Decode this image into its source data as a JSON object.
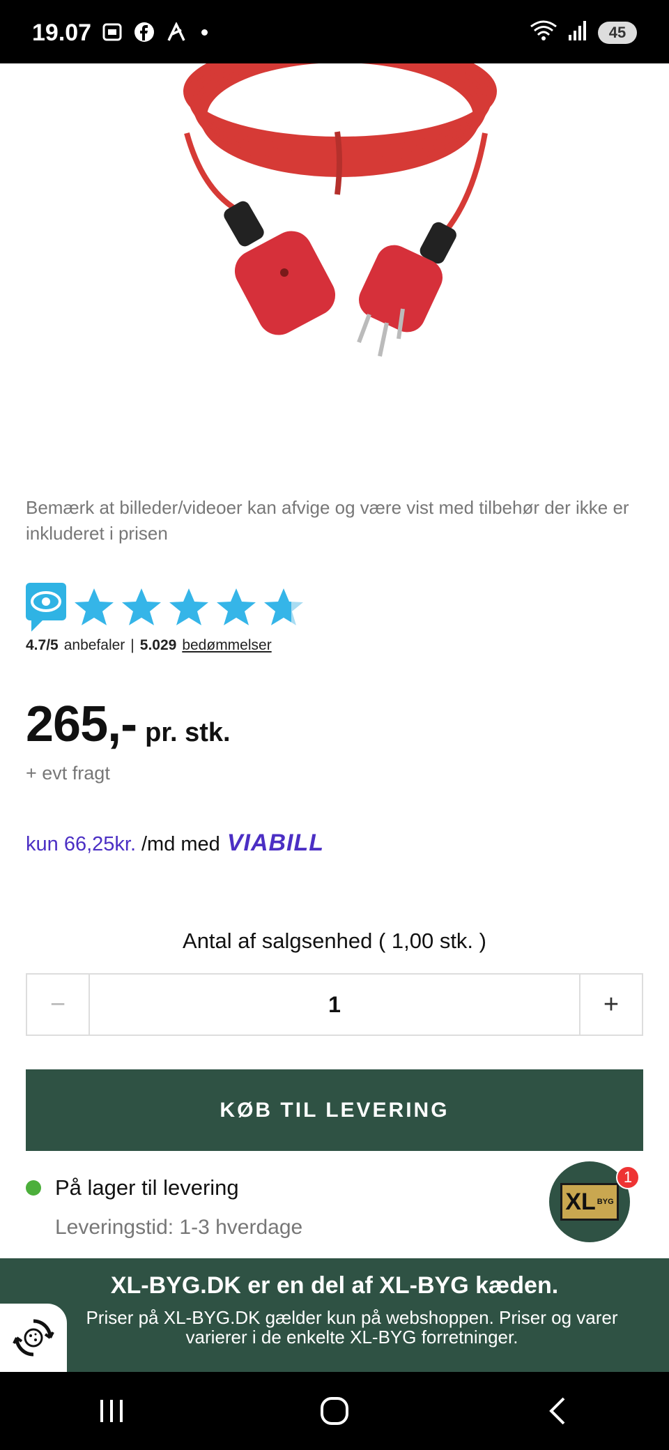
{
  "status_bar": {
    "time": "19.07",
    "battery": "45",
    "icons": [
      "screenshot-icon",
      "facebook-icon",
      "app-icon",
      "wifi-icon",
      "signal-icon",
      "battery-icon"
    ]
  },
  "product": {
    "image_alt": "red extension cable",
    "disclaimer": "Bemærk at billeder/videoer kan afvige og være vist med tilbehør der ikke er inkluderet i prisen"
  },
  "rating": {
    "score": "4.7/5",
    "recommend_label": "anbefaler",
    "separator": "|",
    "count": "5.029",
    "reviews_label": "bedømmelser",
    "stars": 4.7
  },
  "price": {
    "amount": "265,-",
    "unit": "pr. stk.",
    "shipping": "+ evt fragt"
  },
  "viabill": {
    "amount": "kun 66,25kr.",
    "middle": "/md med",
    "logo": "VIABILL"
  },
  "quantity": {
    "label": "Antal af salgsenhed ( 1,00 stk. )",
    "minus": "−",
    "value": "1",
    "plus": "+"
  },
  "buy_button": {
    "label": "KØB TIL LEVERING"
  },
  "stock": {
    "status": "På lager til levering",
    "delivery": "Leveringstid: 1-3 hverdage"
  },
  "chat_badge": {
    "logo": "XL",
    "logo_small": "BYG",
    "count": "1"
  },
  "footer": {
    "title": "XL-BYG.DK er en del af XL-BYG kæden.",
    "text": "Priser på XL-BYG.DK gælder kun på webshoppen. Priser og varer varierer i de enkelte XL-BYG forretninger."
  },
  "colors": {
    "brand_green": "#2f5244",
    "viabill_purple": "#4b2fc4",
    "star_blue": "#35b5e8",
    "stock_green": "#4caf3b"
  }
}
